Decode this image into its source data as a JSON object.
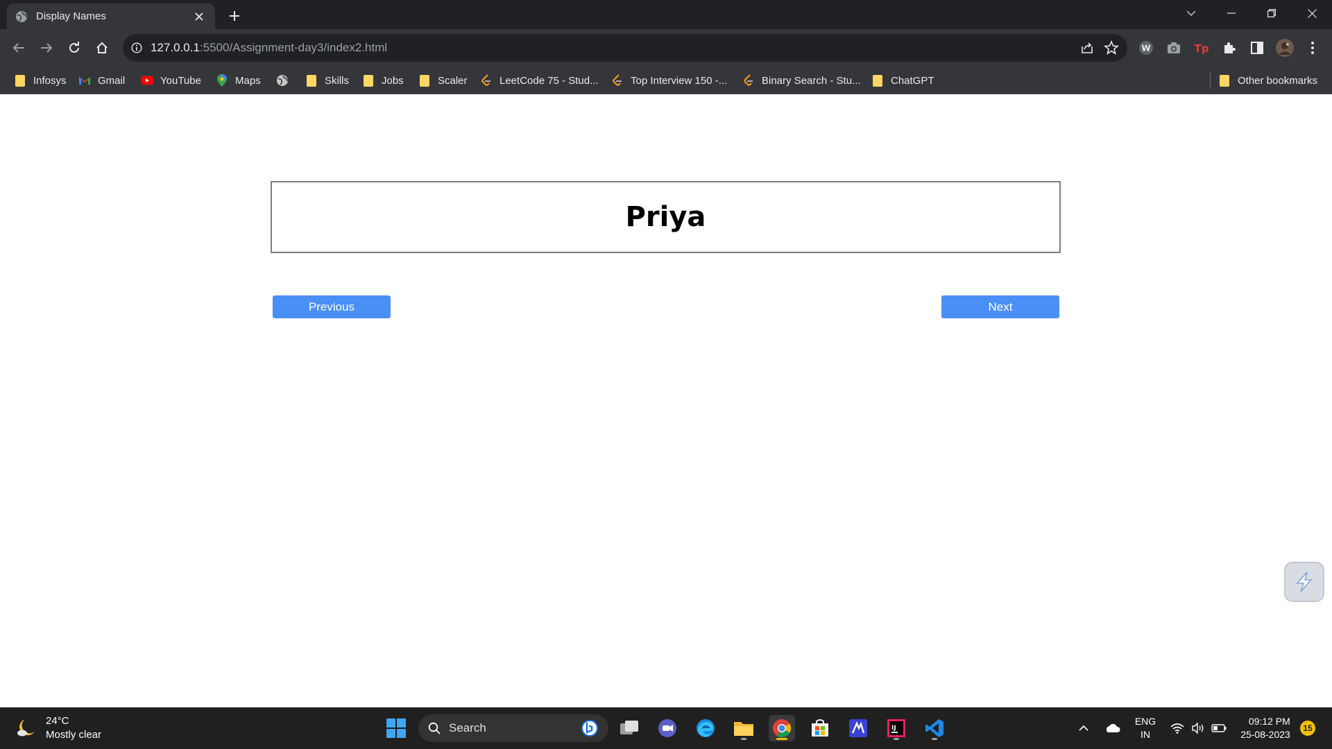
{
  "browser": {
    "tab_title": "Display Names",
    "url_host": "127.0.0.1",
    "url_rest": ":5500/Assignment-day3/index2.html"
  },
  "bookmarks": [
    {
      "label": "Infosys",
      "icon": "folder-icon"
    },
    {
      "label": "Gmail",
      "icon": "gmail-icon"
    },
    {
      "label": "YouTube",
      "icon": "youtube-icon"
    },
    {
      "label": "Maps",
      "icon": "maps-icon"
    },
    {
      "label": "",
      "icon": "globe-icon"
    },
    {
      "label": "Skills",
      "icon": "folder-icon"
    },
    {
      "label": "Jobs",
      "icon": "folder-icon"
    },
    {
      "label": "Scaler",
      "icon": "folder-icon"
    },
    {
      "label": "LeetCode 75 - Stud...",
      "icon": "leetcode-icon"
    },
    {
      "label": "Top Interview 150 -...",
      "icon": "leetcode-icon"
    },
    {
      "label": "Binary Search - Stu...",
      "icon": "leetcode-icon"
    },
    {
      "label": "ChatGPT",
      "icon": "folder-icon"
    }
  ],
  "other_bookmarks": "Other bookmarks",
  "page": {
    "name": "Priya",
    "previous_label": "Previous",
    "next_label": "Next"
  },
  "taskbar": {
    "weather_temp": "24°C",
    "weather_desc": "Mostly clear",
    "search_label": "Search",
    "lang_line1": "ENG",
    "lang_line2": "IN",
    "time": "09:12 PM",
    "date": "25-08-2023",
    "notification_count": "15"
  },
  "colors": {
    "button_blue": "#4a8ff5",
    "chrome_dark": "#202124",
    "chrome_toolbar": "#35363a",
    "taskbar": "#202020"
  }
}
